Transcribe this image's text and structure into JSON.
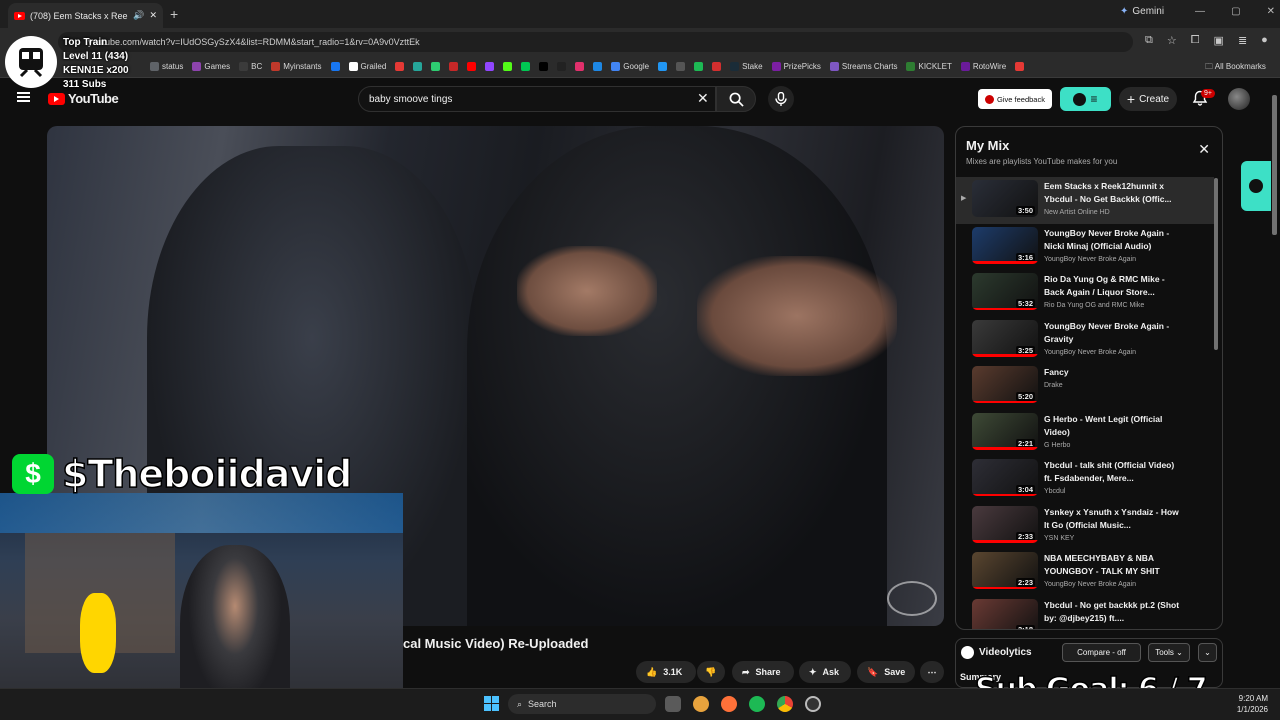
{
  "browser": {
    "tab_title": "(708) Eem Stacks x Reek12h...",
    "new_tab": "+",
    "gemini_label": "Gemini",
    "url": "youtube.com/watch?v=IUdOSGySzX4&list=RDMM&start_radio=1&rv=0A9v0VzttEk",
    "bookmarks": [
      {
        "label": "status",
        "color": "#5f6368"
      },
      {
        "label": "Games",
        "color": "#8e44ad"
      },
      {
        "label": "BC",
        "color": "#3b3b3b"
      },
      {
        "label": "Myinstants",
        "color": "#c0392b"
      },
      {
        "label": "",
        "color": "#1877f2"
      },
      {
        "label": "Grailed",
        "color": "#ffffff"
      },
      {
        "label": "",
        "color": "#e53935"
      },
      {
        "label": "",
        "color": "#26a69a"
      },
      {
        "label": "",
        "color": "#2ecc71"
      },
      {
        "label": "",
        "color": "#c62828"
      },
      {
        "label": "",
        "color": "#ff0000"
      },
      {
        "label": "",
        "color": "#9146ff"
      },
      {
        "label": "",
        "color": "#53fc18"
      },
      {
        "label": "",
        "color": "#00c853"
      },
      {
        "label": "",
        "color": "#000000"
      },
      {
        "label": "",
        "color": "#222222"
      },
      {
        "label": "",
        "color": "#e1306c"
      },
      {
        "label": "",
        "color": "#1e88e5"
      },
      {
        "label": "Google",
        "color": "#4285f4"
      },
      {
        "label": "",
        "color": "#2196f3"
      },
      {
        "label": "",
        "color": "#555555"
      },
      {
        "label": "",
        "color": "#1db954"
      },
      {
        "label": "",
        "color": "#d32f2f"
      },
      {
        "label": "Stake",
        "color": "#1a2c38"
      },
      {
        "label": "PrizePicks",
        "color": "#7b1fa2"
      },
      {
        "label": "Streams Charts",
        "color": "#7e57c2"
      },
      {
        "label": "KICKLET",
        "color": "#2e7d32"
      },
      {
        "label": "RotoWire",
        "color": "#6a1b9a"
      },
      {
        "label": "",
        "color": "#e53935"
      }
    ],
    "all_bookmarks": "All Bookmarks"
  },
  "youtube": {
    "logo_text": "YouTube",
    "search_value": "baby smoove tings",
    "give_feedback": "Give feedback",
    "create": "Create",
    "notif_badge": "9+",
    "video_title": "cal Music Video) Re-Uploaded",
    "likes": "3.1K",
    "share": "Share",
    "ask": "Ask",
    "save": "Save",
    "more": "⋯"
  },
  "mix": {
    "title": "My Mix",
    "subtitle": "Mixes are playlists YouTube makes for you",
    "items": [
      {
        "title": "Eem Stacks x Reek12hunnit x Ybcdul - No Get Backkk (Offic...",
        "channel": "New Artist Online HD",
        "duration": "3:50",
        "thumb": "#2a2e38",
        "active": true,
        "progress": 0.0
      },
      {
        "title": "YoungBoy Never Broke Again - Nicki Minaj (Official Audio)",
        "channel": "YoungBoy Never Broke Again",
        "duration": "3:16",
        "thumb": "#1d3c6b",
        "active": false,
        "progress": 1.0
      },
      {
        "title": "Rio Da Yung Og & RMC Mike - Back Again / Liquor Store...",
        "channel": "Rio Da Yung OG and RMC Mike",
        "duration": "5:32",
        "thumb": "#2c3a2e",
        "active": false,
        "progress": 1.0
      },
      {
        "title": "YoungBoy Never Broke Again - Gravity",
        "channel": "YoungBoy Never Broke Again",
        "duration": "3:25",
        "thumb": "#3a3a3a",
        "active": false,
        "progress": 1.0
      },
      {
        "title": "Fancy",
        "channel": "Drake",
        "duration": "5:20",
        "thumb": "#5a3b2e",
        "active": false,
        "progress": 1.0
      },
      {
        "title": "G Herbo - Went Legit (Official Video)",
        "channel": "G Herbo",
        "duration": "2:21",
        "thumb": "#3e4a36",
        "active": false,
        "progress": 1.0
      },
      {
        "title": "Ybcdul - talk shit (Official Video) ft. Fsdabender, Mere...",
        "channel": "Ybcdul",
        "duration": "3:04",
        "thumb": "#2e2e36",
        "active": false,
        "progress": 1.0
      },
      {
        "title": "Ysnkey x Ysnuth x Ysndaiz - How It Go (Official Music...",
        "channel": "YSN KEY",
        "duration": "2:33",
        "thumb": "#4a3a3e",
        "active": false,
        "progress": 1.0
      },
      {
        "title": "NBA MEECHYBABY & NBA YOUNGBOY - TALK MY SHIT",
        "channel": "YoungBoy Never Broke Again",
        "duration": "2:23",
        "thumb": "#5a4630",
        "active": false,
        "progress": 1.0
      },
      {
        "title": "Ybcdul - No get backkk pt.2 (Shot by: @djbey215) ft....",
        "channel": "",
        "duration": "2:18",
        "thumb": "#6a3a34",
        "active": false,
        "progress": 1.0
      }
    ]
  },
  "videolytics": {
    "name": "Videolytics",
    "compare": "Compare - off",
    "tools": "Tools",
    "summary": "Summary"
  },
  "stream_overlay": {
    "cashtag": "$Theboiidavid",
    "cash_symbol": "$",
    "train_line1": "Top Train",
    "train_line2": "Level 11  (434)",
    "train_line3": "KENN1E x200",
    "train_line4": "311 Subs",
    "sub_goal": "Sub Goal:  6 / 7"
  },
  "taskbar": {
    "search": "Search",
    "time": "9:20 AM",
    "date": "1/1/2026"
  }
}
